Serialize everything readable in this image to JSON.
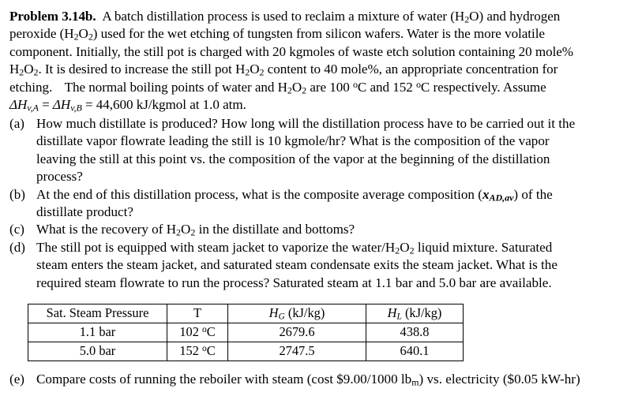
{
  "document": {
    "type": "textbook-problem",
    "problem_label": "Problem 3.14b.",
    "background_color": "#ffffff",
    "text_color": "#000000"
  },
  "intro": {
    "line1_a": "A batch distillation process is used to reclaim a mixture of water (H",
    "line1_b": "2",
    "line1_c": "O) and hydrogen",
    "line2": "peroxide (H",
    "line2_sub1": "2",
    "line2_mid": "O",
    "line2_sub2": "2",
    "line2_end": ") used for the wet etching of tungsten from silicon wafers.  Water is the more volatile",
    "line3": "component.  Initially, the still pot is charged with 20 kgmoles of waste etch solution containing 20 mole%",
    "line4_a": "H",
    "line4_sub1": "2",
    "line4_b": "O",
    "line4_sub2": "2",
    "line4_c": ".  It is desired to increase the still pot H",
    "line4_sub3": "2",
    "line4_d": "O",
    "line4_sub4": "2",
    "line4_e": " content to 40 mole%, an appropriate concentration for",
    "line5_a": "etching.",
    "line5_b": "The normal boiling points of water and H",
    "line5_sub1": "2",
    "line5_c": "O",
    "line5_sub2": "2",
    "line5_d": " are 100 ",
    "line5_deg1": "o",
    "line5_e": "C and 152 ",
    "line5_deg2": "o",
    "line5_f": "C respectively.  Assume",
    "line6_dH1": "ΔH",
    "line6_sub1": "v,A",
    "line6_eq1": " = ",
    "line6_dH2": "ΔH",
    "line6_sub2": "v,B",
    "line6_eq2": "  =  44,600 kJ/kgmol at 1.0 atm."
  },
  "items": [
    {
      "tag": "(a)",
      "lines": [
        "How much distillate is produced?  How long will the distillation process have to be carried out it the",
        "distillate vapor flowrate leading the still is 10 kgmole/hr?  What is the composition of the vapor",
        "leaving the still at this point vs. the composition of the vapor at the beginning of the distillation",
        "process?"
      ]
    },
    {
      "tag": "(b)",
      "line1_a": "At the end of this distillation process, what is the composite average composition (",
      "line1_sym": "x",
      "line1_sub": "AD,av",
      "line1_b": ") of the",
      "line2": "distillate product?"
    },
    {
      "tag": "(c)",
      "line1_a": "What is the recovery of H",
      "line1_sub1": "2",
      "line1_b": "O",
      "line1_sub2": "2",
      "line1_c": " in the distillate and bottoms?"
    },
    {
      "tag": "(d)",
      "line1_a": "The still pot is equipped with steam jacket to vaporize the water/H",
      "line1_sub1": "2",
      "line1_b": "O",
      "line1_sub2": "2",
      "line1_c": " liquid mixture.  Saturated",
      "line2": "steam enters the steam jacket, and saturated steam condensate exits the steam jacket.  What is the",
      "line3": "required steam flowrate to run the process?  Saturated steam at 1.1 bar and 5.0 bar are available."
    }
  ],
  "table": {
    "headers": {
      "pressure": "Sat. Steam Pressure",
      "temperature": "T",
      "hg_sym": "H",
      "hg_sub": "G",
      "hg_unit": " (kJ/kg)",
      "hl_sym": "H",
      "hl_sub": "L",
      "hl_unit": " (kJ/kg)"
    },
    "rows": [
      {
        "pressure": "1.1 bar",
        "temperature_value": "102 ",
        "temperature_deg": "o",
        "temperature_unit": "C",
        "hg": "2679.6",
        "hl": "438.8"
      },
      {
        "pressure": "5.0 bar",
        "temperature_value": "152 ",
        "temperature_deg": "o",
        "temperature_unit": "C",
        "hg": "2747.5",
        "hl": "640.1"
      }
    ]
  },
  "final_item": {
    "tag": "(e)",
    "text_a": "Compare costs of running the reboiler with steam (cost $9.00/1000 lb",
    "text_sub": "m",
    "text_b": ") vs. electricity ($0.05 kW-hr)"
  }
}
